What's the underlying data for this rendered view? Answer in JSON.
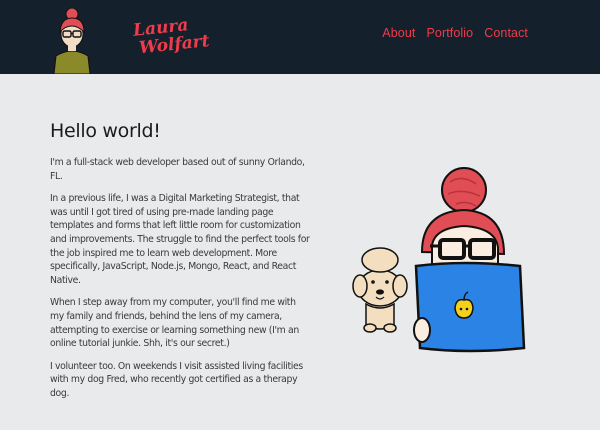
{
  "header": {
    "logo_line1": "Laura",
    "logo_line2": "Wolfart",
    "bg_color": "#14202b",
    "accent_color": "#ef3b4a"
  },
  "nav": {
    "items": [
      {
        "label": "About"
      },
      {
        "label": "Portfolio"
      },
      {
        "label": "Contact"
      }
    ]
  },
  "main": {
    "title": "Hello world!",
    "paragraphs": [
      "I'm a full-stack web developer based out of sunny Orlando, FL.",
      "In a previous life, I was a Digital Marketing Strategist, that was until I got tired of using pre-made landing page templates and forms that left little room for customization and improvements. The struggle to find the perfect tools for the job inspired me to learn web development. More specifically, JavaScript, Node.js, Mongo, React, and React Native.",
      "When I step away from my computer, you'll find me with my family and friends, behind the lens of my camera, attempting to exercise or learning something new (I'm an online tutorial junkie. Shh, it's our secret.)",
      "I volunteer too. On weekends I visit assisted living facilities with my dog Fred, who recently got certified as a therapy dog."
    ]
  },
  "illustration": {
    "subject": "girl-with-laptop-and-dog",
    "laptop_color": "#2b83e6",
    "hair_color": "#e04d54"
  }
}
